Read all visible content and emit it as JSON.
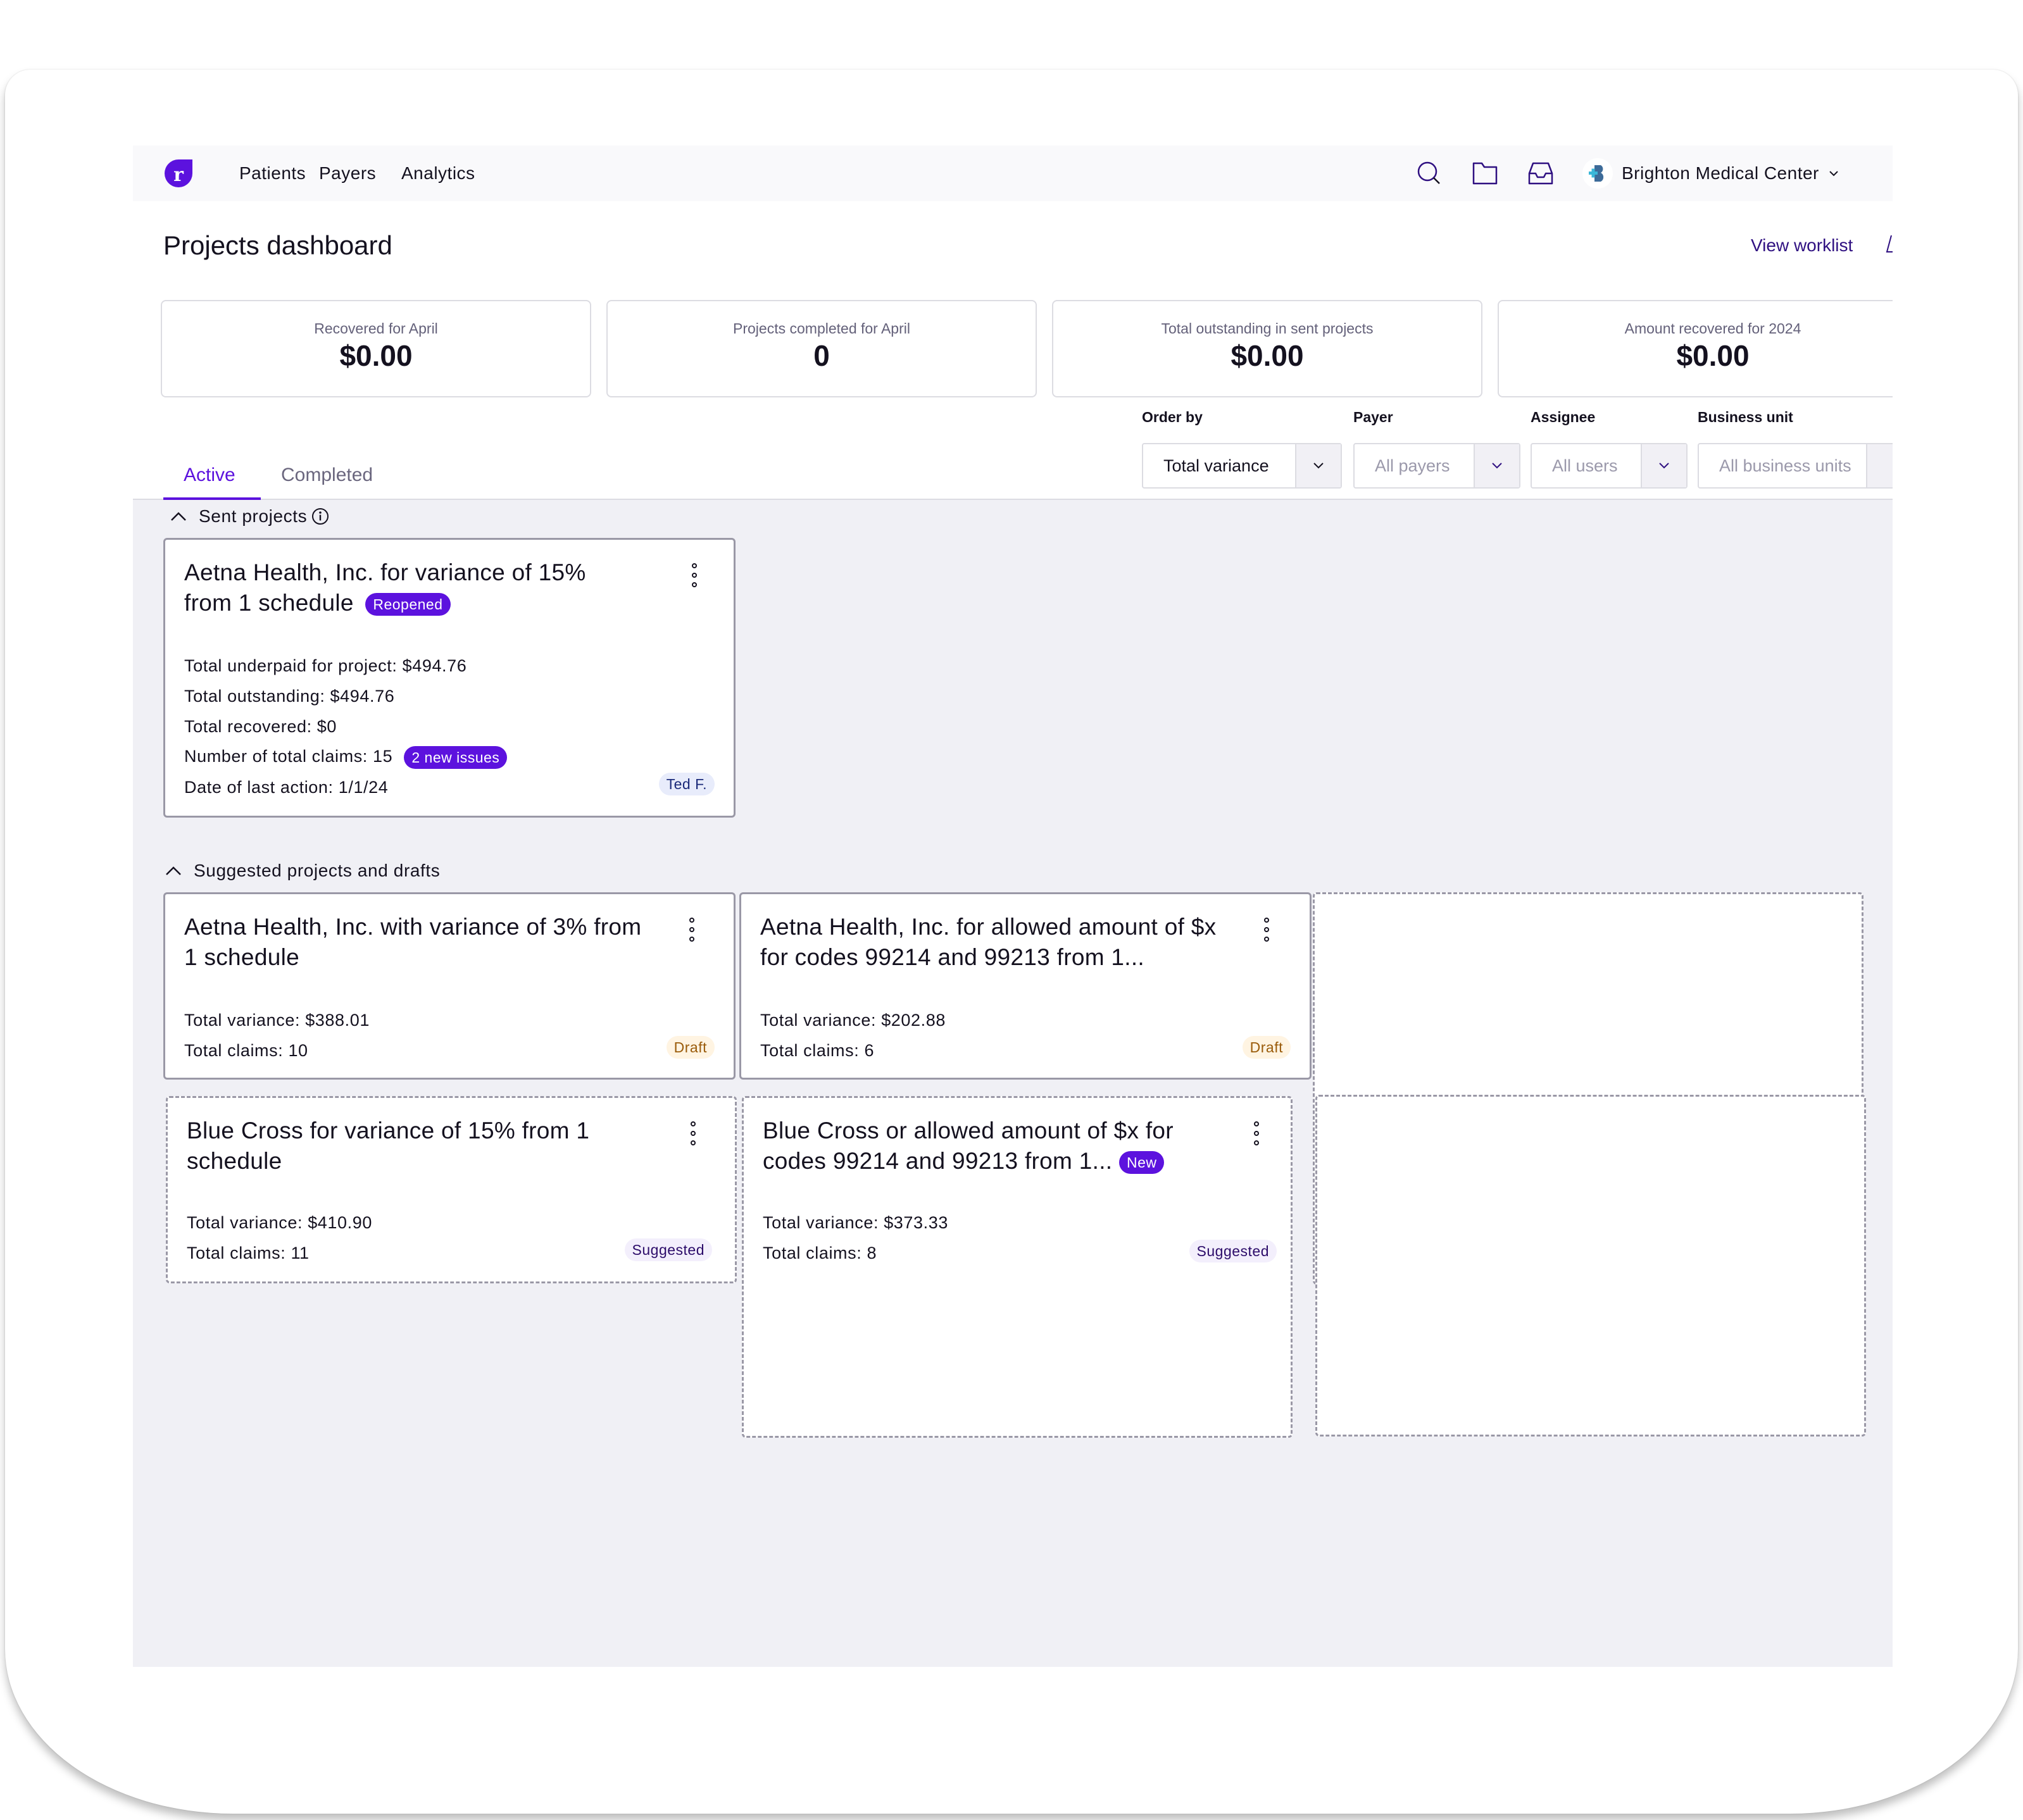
{
  "nav": {
    "links": [
      "Patients",
      "Payers",
      "Analytics"
    ],
    "icons": [
      "search-icon",
      "folder-icon",
      "inbox-icon"
    ],
    "organization": "Brighton Medical Center"
  },
  "header": {
    "title": "Projects dashboard",
    "view_worklist": "View worklist"
  },
  "stats": [
    {
      "label": "Recovered for April",
      "value": "$0.00"
    },
    {
      "label": "Projects completed for April",
      "value": "0"
    },
    {
      "label": "Total outstanding in sent projects",
      "value": "$0.00"
    },
    {
      "label": "Amount recovered for 2024",
      "value": "$0.00"
    }
  ],
  "filters": {
    "order_by": {
      "label": "Order by",
      "value": "Total variance"
    },
    "payer": {
      "label": "Payer",
      "placeholder": "All payers"
    },
    "assignee": {
      "label": "Assignee",
      "placeholder": "All users"
    },
    "business_unit": {
      "label": "Business unit",
      "placeholder": "All business units"
    }
  },
  "tabs": {
    "active": "Active",
    "completed": "Completed",
    "selected": "Active"
  },
  "sent_projects": {
    "heading": "Sent projects",
    "cards": [
      {
        "title": "Aetna Health, Inc. for variance of 15% from 1 schedule",
        "status_badge": "Reopened",
        "rows": [
          "Total underpaid for project: $494.76",
          "Total outstanding: $494.76",
          "Total recovered: $0",
          "Number of total claims: 15",
          "Date of last action: 1/1/24"
        ],
        "issues_badge": "2 new issues",
        "assignee": "Ted F."
      }
    ]
  },
  "suggested": {
    "heading": "Suggested projects and drafts",
    "cards": [
      {
        "title": "Aetna Health, Inc. with variance of 3% from 1 schedule",
        "variance": "Total variance: $388.01",
        "claims": "Total claims: 10",
        "status": "Draft"
      },
      {
        "title": "Aetna Health, Inc. for allowed amount of $x for codes 99214 and 99213 from 1...",
        "variance": "Total variance: $202.88",
        "claims": "Total claims: 6",
        "status": "Draft"
      },
      {
        "title": "Blue Cross for variance of 15% from 1 schedule",
        "variance": "Total variance: $410.90",
        "claims": "Total claims: 11",
        "status": "Suggested"
      },
      {
        "title": "Blue Cross or allowed amount of $x for codes 99214 and 99213 from 1...",
        "new_badge": "New",
        "variance": "Total variance: $373.33",
        "claims": "Total claims: 8",
        "status": "Suggested"
      }
    ]
  },
  "colors": {
    "brand": "#5c12de",
    "link": "#2f1081",
    "content_bg": "#f0f0f5",
    "draft_bg": "#fff4e2",
    "suggested_bg": "#f3effc"
  }
}
